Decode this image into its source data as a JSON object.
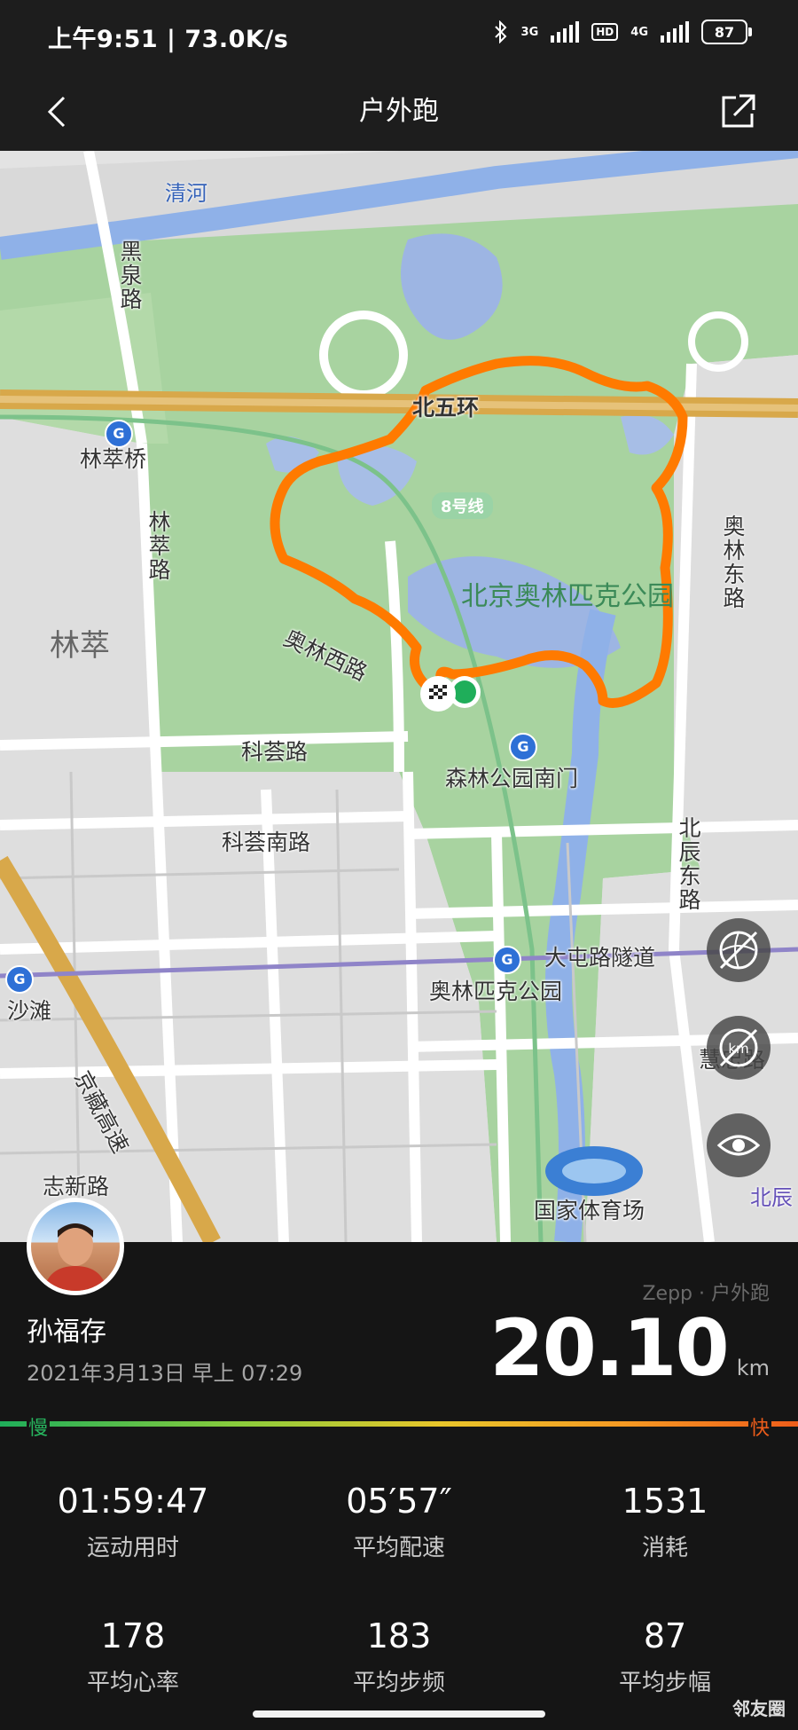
{
  "status_bar": {
    "time_speed": "上午9:51 | 73.0K/s",
    "net_3g": "3G",
    "hd": "HD",
    "net_4g": "4G",
    "battery": "87",
    "bluetooth_icon": "bluetooth-icon"
  },
  "header": {
    "title": "户外跑",
    "back_icon": "chevron-left-icon",
    "share_icon": "share-icon"
  },
  "map": {
    "labels": {
      "qinghe": "清河",
      "heiquan": "黑泉路",
      "beiwuhuan": "北五环",
      "lincuiqiao": "林萃桥",
      "line8": "8号线",
      "lincui_road": "林萃路",
      "aolin_dong": "奥林东路",
      "park": "北京奥林匹克公园",
      "lincui": "林萃",
      "aolin_xi": "奥林西路",
      "kehui": "科荟路",
      "south_gate": "森林公园南门",
      "kehui_nan": "科荟南路",
      "beichen_dong": "北辰东路",
      "datun_tunnel": "大屯路隧道",
      "aolinpike": "奥林匹克公园",
      "shatan": "沙滩",
      "jingzang": "京藏高速",
      "huizhong": "慧忠路",
      "zhixin": "志新路",
      "stadium": "国家体育场",
      "beichen": "北辰"
    },
    "route_color": "#ff7a00",
    "park_color": "#9ecb8f",
    "controls": [
      "route-toggle-icon",
      "km-marker-toggle-icon",
      "eye-icon"
    ]
  },
  "summary": {
    "brand": "Zepp · 户外跑",
    "user_name": "孙福存",
    "date": "2021年3月13日 早上 07:29",
    "distance": "20.10",
    "distance_unit": "km",
    "pace_slow": "慢",
    "pace_fast": "快"
  },
  "stats": [
    {
      "value": "01:59:47",
      "label": "运动用时"
    },
    {
      "value": "05′57″",
      "label": "平均配速"
    },
    {
      "value": "1531",
      "label": "消耗"
    },
    {
      "value": "178",
      "label": "平均心率"
    },
    {
      "value": "183",
      "label": "平均步频"
    },
    {
      "value": "87",
      "label": "平均步幅"
    }
  ],
  "watermark": "邻友圈"
}
